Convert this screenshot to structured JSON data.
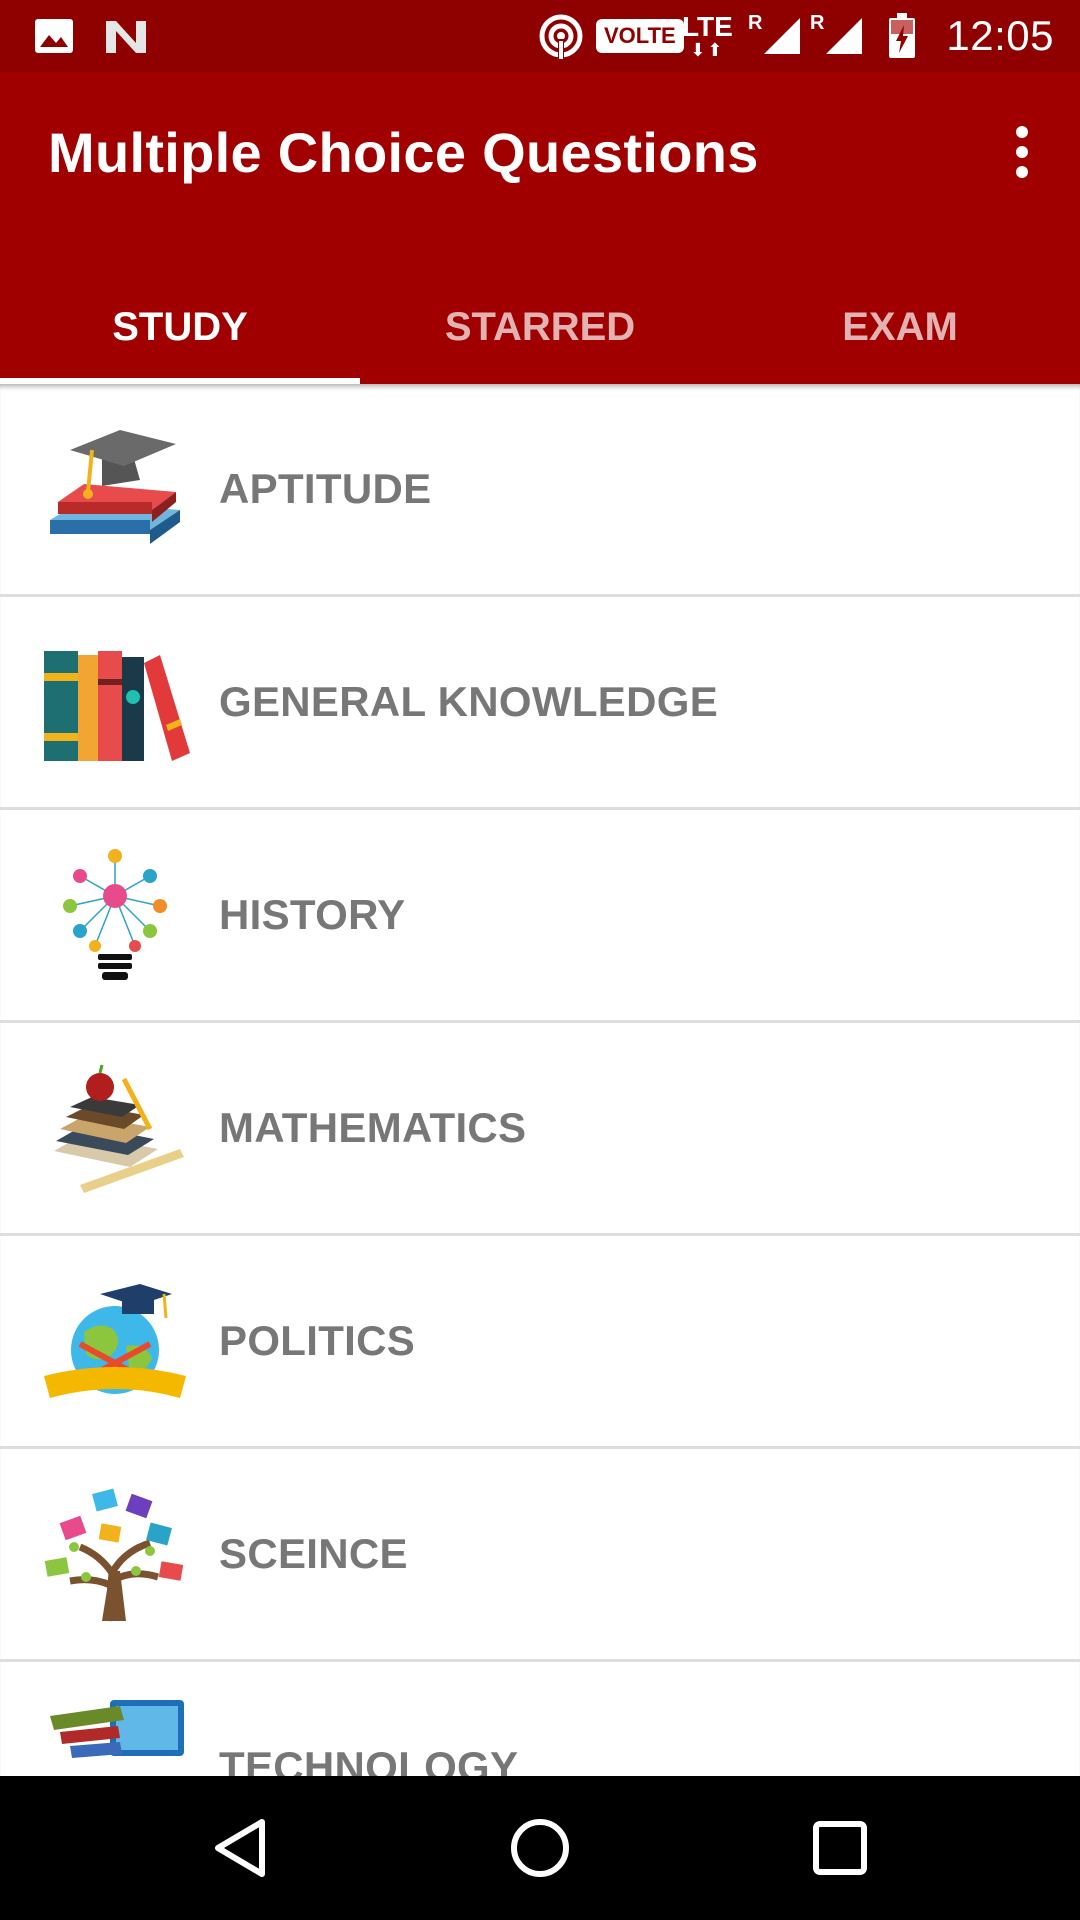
{
  "status_bar": {
    "time": "12:05",
    "volte_label": "VOLTE",
    "lte_label": "LTE",
    "roaming_label": "R",
    "icons": [
      "image-icon",
      "n-logo-icon",
      "hotspot-icon",
      "volte-icon",
      "lte-icon",
      "signal-icon",
      "signal-icon",
      "battery-charging-icon"
    ]
  },
  "app_bar": {
    "title": "Multiple Choice Questions",
    "menu_icon": "more-vert-icon"
  },
  "tabs": [
    {
      "label": "STUDY",
      "active": true
    },
    {
      "label": "STARRED",
      "active": false
    },
    {
      "label": "EXAM",
      "active": false
    }
  ],
  "categories": [
    {
      "label": "APTITUDE",
      "icon": "graduation-books-icon"
    },
    {
      "label": "GENERAL KNOWLEDGE",
      "icon": "books-icon"
    },
    {
      "label": "HISTORY",
      "icon": "lightbulb-network-icon"
    },
    {
      "label": "MATHEMATICS",
      "icon": "books-apple-icon"
    },
    {
      "label": "POLITICS",
      "icon": "globe-cap-icon"
    },
    {
      "label": "SCEINCE",
      "icon": "book-tree-icon"
    },
    {
      "label": "TECHNOLOGY",
      "icon": "laptop-books-icon"
    }
  ],
  "nav_bar": {
    "icons": [
      "back-icon",
      "home-icon",
      "recents-icon"
    ]
  },
  "colors": {
    "status_bar": "#8f0000",
    "app_bar": "#a00000",
    "label_text": "#777777",
    "divider": "#dddddd"
  }
}
